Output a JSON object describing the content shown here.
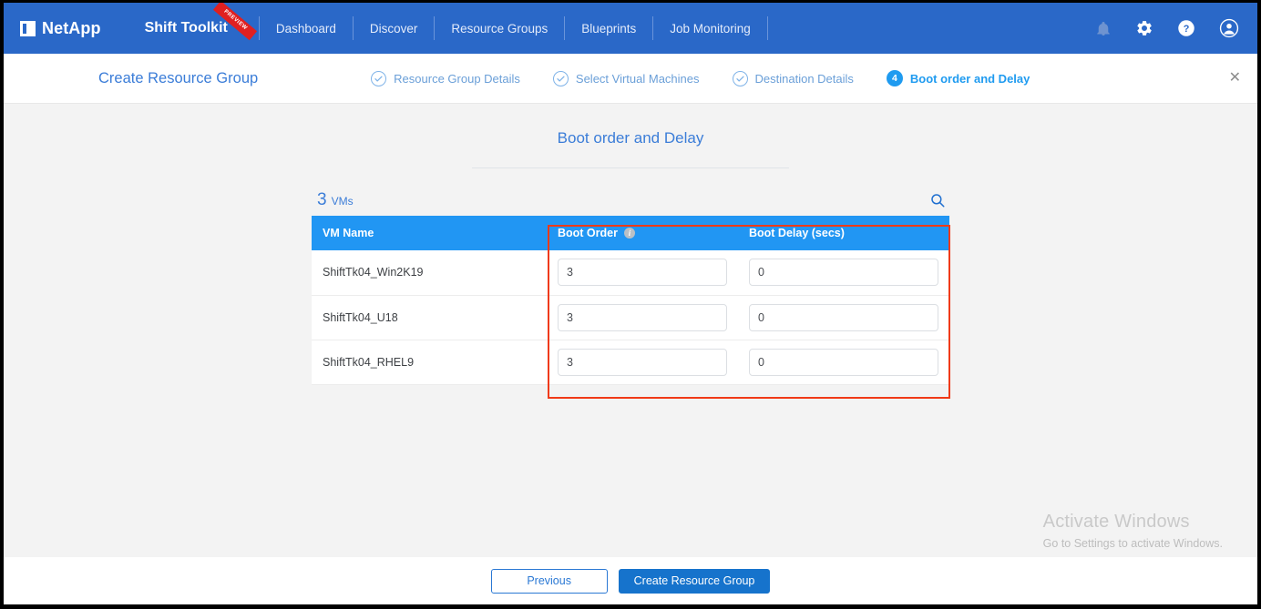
{
  "brand": {
    "logo_icon": "netapp-logo-icon",
    "name": "NetApp",
    "app_title": "Shift Toolkit",
    "ribbon_label": "PREVIEW"
  },
  "nav": {
    "items": [
      {
        "label": "Dashboard"
      },
      {
        "label": "Discover"
      },
      {
        "label": "Resource Groups"
      },
      {
        "label": "Blueprints"
      },
      {
        "label": "Job Monitoring"
      }
    ],
    "right_icons": [
      {
        "name": "notification-bell-icon"
      },
      {
        "name": "settings-gear-icon"
      },
      {
        "name": "help-icon"
      },
      {
        "name": "account-icon"
      }
    ]
  },
  "wizard": {
    "title": "Create Resource Group",
    "close_label": "✕",
    "steps": [
      {
        "label": "Resource Group Details",
        "state": "done",
        "number": "1"
      },
      {
        "label": "Select Virtual Machines",
        "state": "done",
        "number": "2"
      },
      {
        "label": "Destination Details",
        "state": "done",
        "number": "3"
      },
      {
        "label": "Boot order and Delay",
        "state": "active",
        "number": "4"
      }
    ]
  },
  "panel": {
    "title": "Boot order and Delay",
    "count_number": "3",
    "count_unit": "VMs",
    "search_icon": "search-icon"
  },
  "table": {
    "columns": {
      "name": "VM Name",
      "order": "Boot Order",
      "order_info_icon": "info-icon",
      "delay": "Boot Delay (secs)"
    },
    "rows": [
      {
        "vm_name": "ShiftTk04_Win2K19",
        "boot_order": "3",
        "boot_delay": "0"
      },
      {
        "vm_name": "ShiftTk04_U18",
        "boot_order": "3",
        "boot_delay": "0"
      },
      {
        "vm_name": "ShiftTk04_RHEL9",
        "boot_order": "3",
        "boot_delay": "0"
      }
    ]
  },
  "footer": {
    "previous_label": "Previous",
    "create_label": "Create Resource Group"
  },
  "watermark": {
    "line1": "Activate Windows",
    "line2": "Go to Settings to activate Windows."
  },
  "colors": {
    "nav_blue": "#2a68c8",
    "accent_blue": "#2196f3",
    "link_blue": "#3b7dd8",
    "annotation_red": "#f03a17",
    "primary_button": "#1673cc"
  }
}
